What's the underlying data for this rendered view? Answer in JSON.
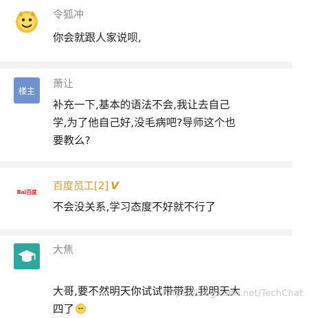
{
  "posts": [
    {
      "username": "令狐冲",
      "avatar": "yellow-cartoon-avatar",
      "message": "你会就跟人家说呗,"
    },
    {
      "username": "萧让",
      "avatar_label": "楼主",
      "message": "补充一下,基本的语法不会,我让去自己\n学,为了他自己好,没毛病吧?导师这个也\n要教么?"
    },
    {
      "username": "百度员工[2]",
      "level_badge": "V",
      "avatar_label": "Bai百度",
      "message": "不会没关系,学习态度不好就不行了"
    },
    {
      "username": "大焦",
      "avatar": "graduation-cap-avatar",
      "message": "大哥,要不然明天你试试带带我,我明天大\n四了",
      "emoji": "smile-emoji"
    }
  ],
  "watermark": "https://blog.csdn.net/TechChat",
  "colors": {
    "username": "#8c8c8c",
    "baidu_gold": "#d39a2a",
    "louzhu_blue": "#6f93c9",
    "teal_avatar": "#2ea79c",
    "divider": "#f3f3f3"
  }
}
